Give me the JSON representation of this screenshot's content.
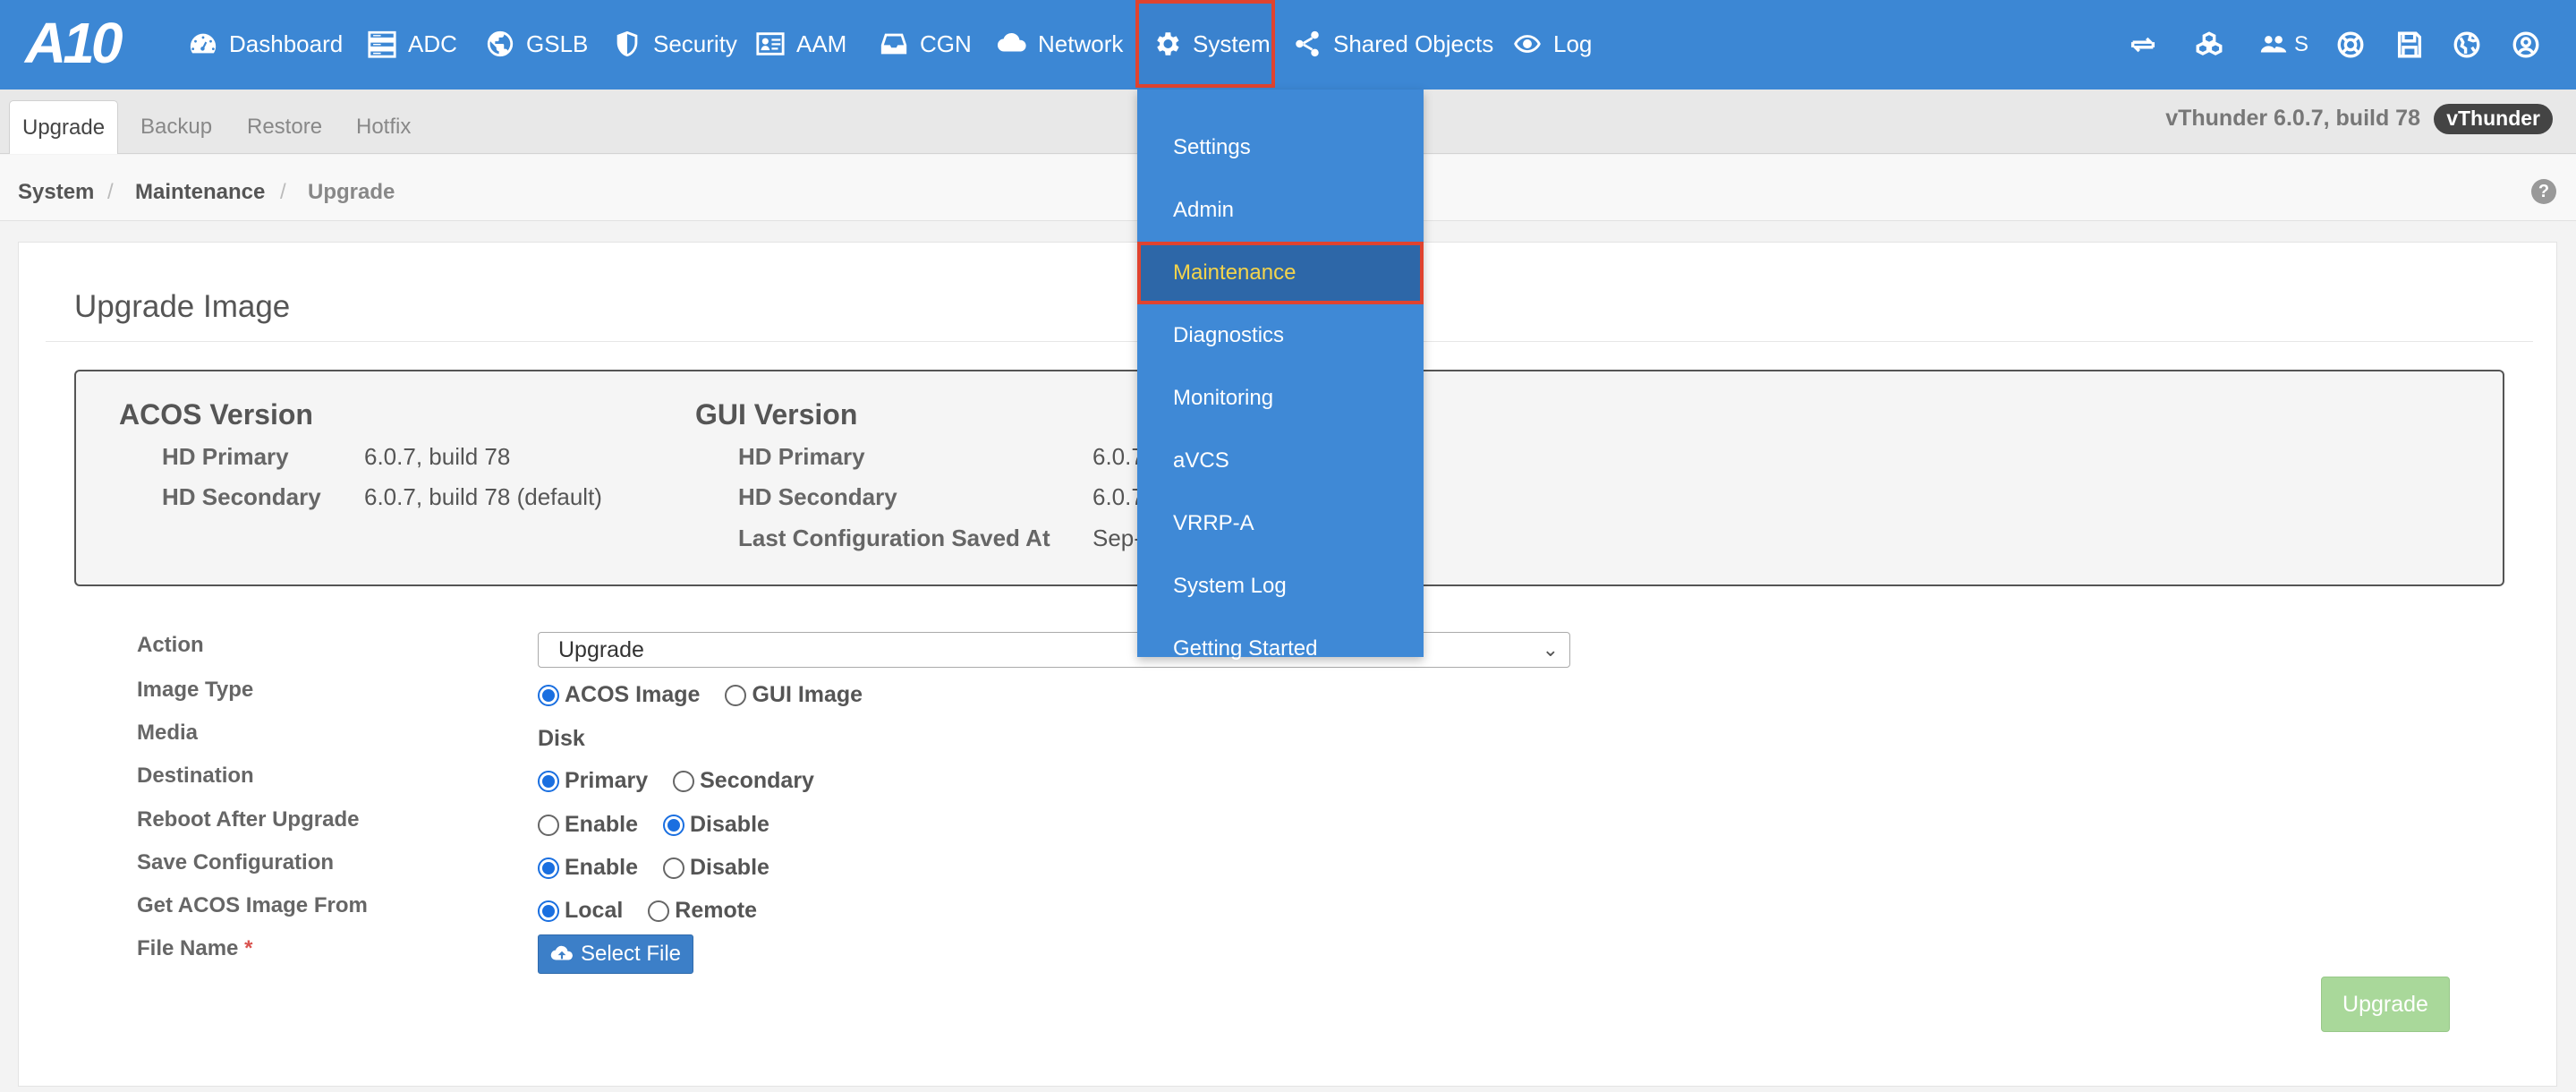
{
  "brand": {
    "logo_text": "A10"
  },
  "nav": {
    "items": [
      {
        "label": "Dashboard",
        "icon": "dashboard-icon"
      },
      {
        "label": "ADC",
        "icon": "server-icon"
      },
      {
        "label": "GSLB",
        "icon": "globe-icon"
      },
      {
        "label": "Security",
        "icon": "shield-icon"
      },
      {
        "label": "AAM",
        "icon": "id-card-icon"
      },
      {
        "label": "CGN",
        "icon": "inbox-icon"
      },
      {
        "label": "Network",
        "icon": "cloud-icon"
      },
      {
        "label": "System",
        "icon": "gear-icon"
      },
      {
        "label": "Shared Objects",
        "icon": "share-icon"
      },
      {
        "label": "Log",
        "icon": "eye-icon"
      }
    ],
    "active": "System",
    "right": {
      "users_label": "S"
    }
  },
  "subtabs": [
    "Upgrade",
    "Backup",
    "Restore",
    "Hotfix"
  ],
  "version": {
    "text": "vThunder 6.0.7, build 78",
    "badge": "vThunder"
  },
  "breadcrumb": [
    "System",
    "Maintenance",
    "Upgrade"
  ],
  "help": "?",
  "panel": {
    "title": "Upgrade Image",
    "acos": {
      "heading": "ACOS Version",
      "rows": [
        {
          "label": "HD Primary",
          "value": "6.0.7, build 78"
        },
        {
          "label": "HD Secondary",
          "value": "6.0.7, build 78 (default)"
        }
      ]
    },
    "gui": {
      "heading": "GUI Version",
      "rows": [
        {
          "label": "HD Primary",
          "value": "6.0.7"
        },
        {
          "label": "HD Secondary",
          "value": "6.0.7"
        },
        {
          "label": "Last Configuration Saved At",
          "value": "Sep-"
        }
      ]
    }
  },
  "form": {
    "action": {
      "label": "Action",
      "value": "Upgrade"
    },
    "image_type": {
      "label": "Image Type",
      "options": [
        "ACOS Image",
        "GUI Image"
      ],
      "selected": "ACOS Image"
    },
    "media": {
      "label": "Media",
      "value": "Disk"
    },
    "destination": {
      "label": "Destination",
      "options": [
        "Primary",
        "Secondary"
      ],
      "selected": "Primary"
    },
    "reboot": {
      "label": "Reboot After Upgrade",
      "options": [
        "Enable",
        "Disable"
      ],
      "selected": "Disable"
    },
    "save_config": {
      "label": "Save Configuration",
      "options": [
        "Enable",
        "Disable"
      ],
      "selected": "Enable"
    },
    "image_from": {
      "label": "Get ACOS Image From",
      "options": [
        "Local",
        "Remote"
      ],
      "selected": "Local"
    },
    "file_name": {
      "label": "File Name",
      "required": "*",
      "button": "Select File"
    },
    "submit": "Upgrade"
  },
  "system_menu": {
    "items": [
      "Settings",
      "Admin",
      "Maintenance",
      "Diagnostics",
      "Monitoring",
      "aVCS",
      "VRRP-A",
      "System Log",
      "Getting Started"
    ],
    "active": "Maintenance"
  }
}
